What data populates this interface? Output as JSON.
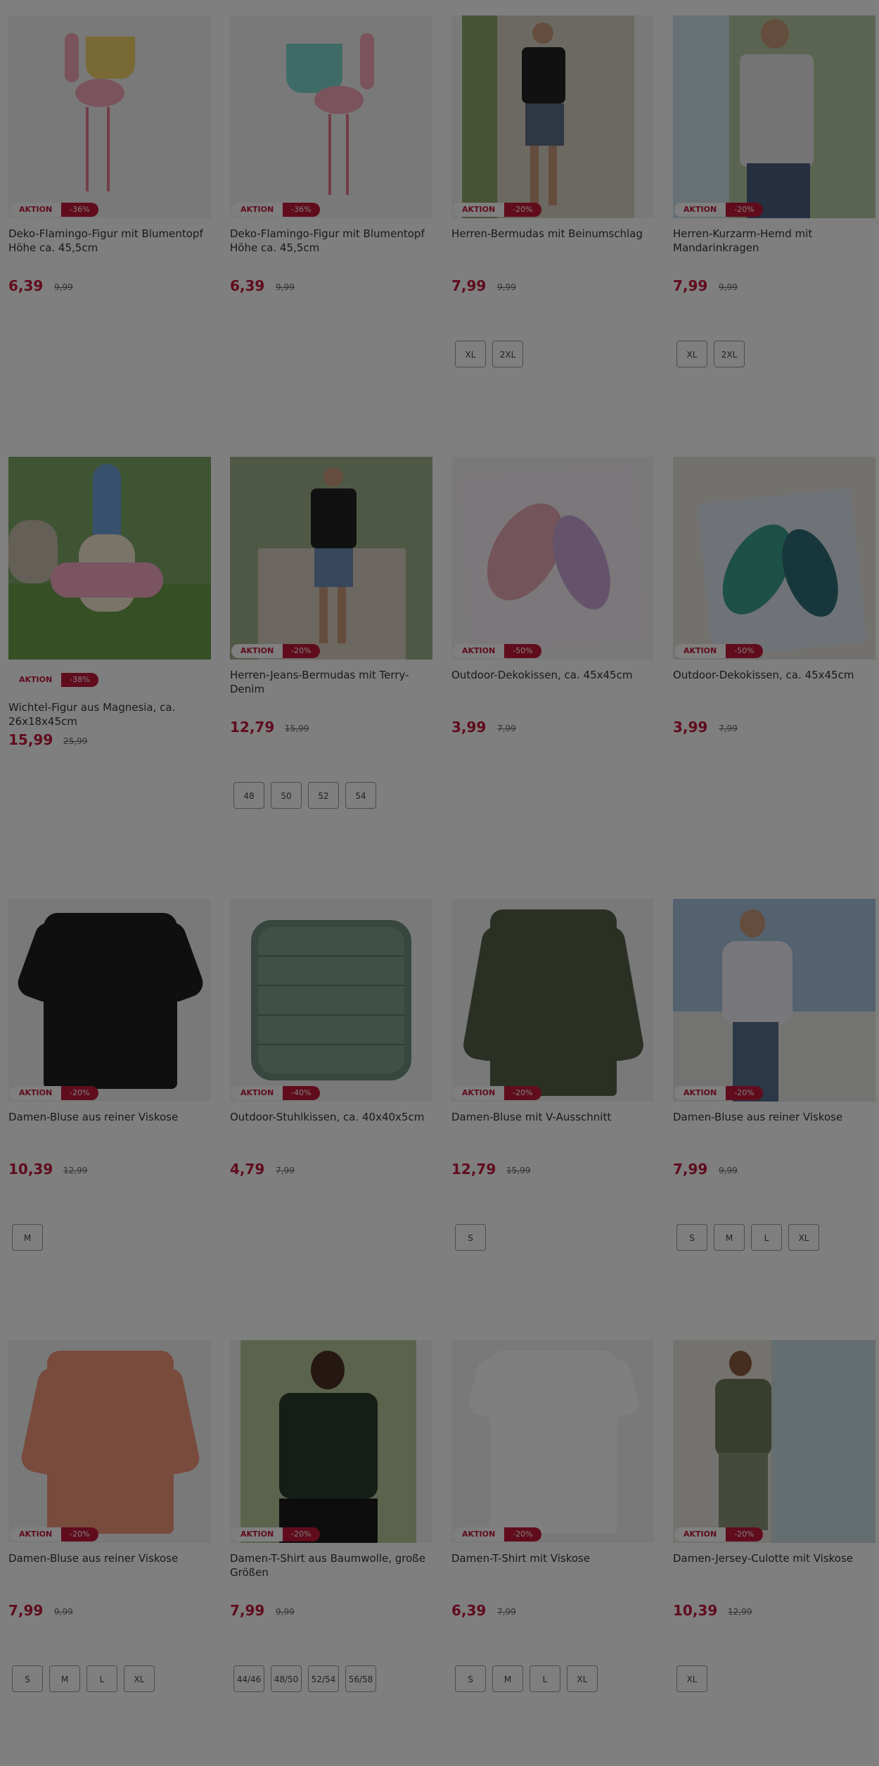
{
  "products": [
    {
      "title": "Deko-Flamingo-Figur mit Blumentopf Höhe ca. 45,5cm",
      "price": "6,39",
      "old_price": "9,99",
      "aktion": "AKTION",
      "discount": "-36%",
      "sizes": [],
      "badge_on_image": true,
      "image": "flamingo-figure-yellow-pot"
    },
    {
      "title": "Deko-Flamingo-Figur mit Blumentopf Höhe ca. 45,5cm",
      "price": "6,39",
      "old_price": "9,99",
      "aktion": "AKTION",
      "discount": "-36%",
      "sizes": [],
      "badge_on_image": true,
      "image": "flamingo-figure-teal-pot"
    },
    {
      "title": "Herren-Bermudas mit Beinumschlag",
      "price": "7,99",
      "old_price": "9,99",
      "aktion": "AKTION",
      "discount": "-20%",
      "sizes": [
        "XL",
        "2XL"
      ],
      "badge_on_image": true,
      "image": "man-bermudas"
    },
    {
      "title": "Herren-Kurzarm-Hemd mit Mandarinkragen",
      "price": "7,99",
      "old_price": "9,99",
      "aktion": "AKTION",
      "discount": "-20%",
      "sizes": [
        "XL",
        "2XL"
      ],
      "badge_on_image": true,
      "image": "man-shirt"
    },
    {
      "title": "Wichtel-Figur aus Magnesia, ca. 26x18x45cm",
      "price": "15,99",
      "old_price": "25,99",
      "aktion": "AKTION",
      "discount": "-38%",
      "sizes": [],
      "badge_on_image": false,
      "image": "gnome-figure"
    },
    {
      "title": "Herren-Jeans-Bermudas mit Terry-Denim",
      "price": "12,79",
      "old_price": "15,99",
      "aktion": "AKTION",
      "discount": "-20%",
      "sizes": [
        "48",
        "50",
        "52",
        "54"
      ],
      "badge_on_image": true,
      "image": "man-jeans-bermudas"
    },
    {
      "title": "Outdoor-Dekokissen, ca. 45x45cm",
      "price": "3,99",
      "old_price": "7,99",
      "aktion": "AKTION",
      "discount": "-50%",
      "sizes": [],
      "badge_on_image": true,
      "image": "pillow-pink-leaves"
    },
    {
      "title": "Outdoor-Dekokissen, ca. 45x45cm",
      "price": "3,99",
      "old_price": "7,99",
      "aktion": "AKTION",
      "discount": "-50%",
      "sizes": [],
      "badge_on_image": true,
      "image": "pillow-green-leaves"
    },
    {
      "title": "Damen-Bluse aus reiner Viskose",
      "price": "10,39",
      "old_price": "12,99",
      "aktion": "AKTION",
      "discount": "-20%",
      "sizes": [
        "M"
      ],
      "badge_on_image": true,
      "image": "black-blouse"
    },
    {
      "title": "Outdoor-Stuhlkissen, ca. 40x40x5cm",
      "price": "4,79",
      "old_price": "7,99",
      "aktion": "AKTION",
      "discount": "-40%",
      "sizes": [],
      "badge_on_image": true,
      "image": "chair-cushion"
    },
    {
      "title": "Damen-Bluse mit V-Ausschnitt",
      "price": "12,79",
      "old_price": "15,99",
      "aktion": "AKTION",
      "discount": "-20%",
      "sizes": [
        "S"
      ],
      "badge_on_image": true,
      "image": "olive-blouse"
    },
    {
      "title": "Damen-Bluse aus reiner Viskose",
      "price": "7,99",
      "old_price": "9,99",
      "aktion": "AKTION",
      "discount": "-20%",
      "sizes": [
        "S",
        "M",
        "L",
        "XL"
      ],
      "badge_on_image": true,
      "image": "woman-white-blouse"
    },
    {
      "title": "Damen-Bluse aus reiner Viskose",
      "price": "7,99",
      "old_price": "9,99",
      "aktion": "AKTION",
      "discount": "-20%",
      "sizes": [
        "S",
        "M",
        "L",
        "XL"
      ],
      "badge_on_image": true,
      "image": "peach-blouse"
    },
    {
      "title": "Damen-T-Shirt aus Baumwolle, große Größen",
      "price": "7,99",
      "old_price": "9,99",
      "aktion": "AKTION",
      "discount": "-20%",
      "sizes": [
        "44/46",
        "48/50",
        "52/54",
        "56/58"
      ],
      "badge_on_image": true,
      "image": "woman-dark-tshirt"
    },
    {
      "title": "Damen-T-Shirt mit Viskose",
      "price": "6,39",
      "old_price": "7,99",
      "aktion": "AKTION",
      "discount": "-20%",
      "sizes": [
        "S",
        "M",
        "L",
        "XL"
      ],
      "badge_on_image": true,
      "image": "white-tshirt"
    },
    {
      "title": "Damen-Jersey-Culotte mit Viskose",
      "price": "10,39",
      "old_price": "12,99",
      "aktion": "AKTION",
      "discount": "-20%",
      "sizes": [
        "XL"
      ],
      "badge_on_image": true,
      "image": "woman-culotte"
    }
  ],
  "colors": {
    "accent": "#c0193a",
    "overlay": "rgba(0,0,0,0.5)"
  }
}
